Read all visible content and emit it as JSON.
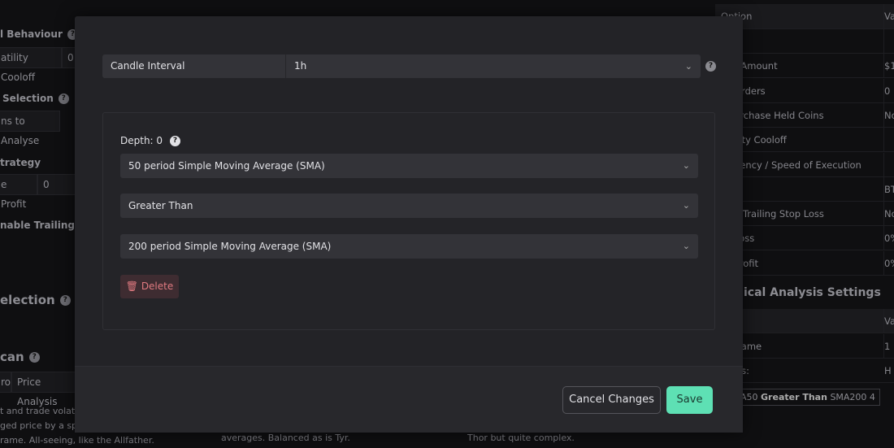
{
  "background": {
    "left": {
      "behaviour_heading": "l Behaviour",
      "volatility_label": "atility Cooloff",
      "volatility_value": "0",
      "selection_heading": "Selection",
      "analyse_label": "ns to Analyse",
      "strategy_heading": "trategy",
      "profit_label": "e Profit",
      "profit_value": "0",
      "trailing_label": "nable Trailing Valu",
      "selection2_heading": "election",
      "scan_heading": "can",
      "tab_pro": "ro",
      "tab_price": "Price Analysis",
      "desc_lines": [
        "t and trade volatile",
        "ged price by a spec",
        "rame. All-seeing, like the Allfather."
      ]
    },
    "middle_desc": "averages. Balanced as is Tyr.",
    "right_desc": "Thor but quite complex.",
    "table": {
      "header": [
        "Option",
        "Va"
      ],
      "rows": [
        [
          "e",
          ""
        ],
        [
          "r Amount",
          "$1"
        ],
        [
          "Orders",
          "0"
        ],
        [
          "urchase Held Coins",
          "No"
        ],
        [
          "ility Cooloff",
          ""
        ],
        [
          "uency / Speed of Execution",
          ""
        ],
        [
          "s",
          "BT"
        ],
        [
          "g Trailing Stop Loss",
          "No"
        ],
        [
          "Loss",
          "0%"
        ],
        [
          "Profit",
          "0%"
        ]
      ],
      "ta_heading": "nical Analysis Settings",
      "ta_header": [
        "n",
        "Va"
      ],
      "ta_rows": [
        [
          "frame",
          "1 H"
        ]
      ],
      "analysis_label": "sis:",
      "analysis_tag": {
        "pre": "A50",
        "bold": "Greater Than",
        "post": "SMA200 4"
      }
    }
  },
  "modal": {
    "candle_label": "Candle Interval",
    "candle_value": "1h",
    "depth_label": "Depth: 0",
    "indicator1": "50 period Simple Moving Average (SMA)",
    "operator": "Greater Than",
    "indicator2": "200 period Simple Moving Average (SMA)",
    "delete_label": "Delete",
    "cancel_label": "Cancel Changes",
    "save_label": "Save"
  },
  "colors": {
    "save": "#5ee0b4",
    "delete_text": "#e07a80",
    "delete_bg": "#3e2c31"
  }
}
